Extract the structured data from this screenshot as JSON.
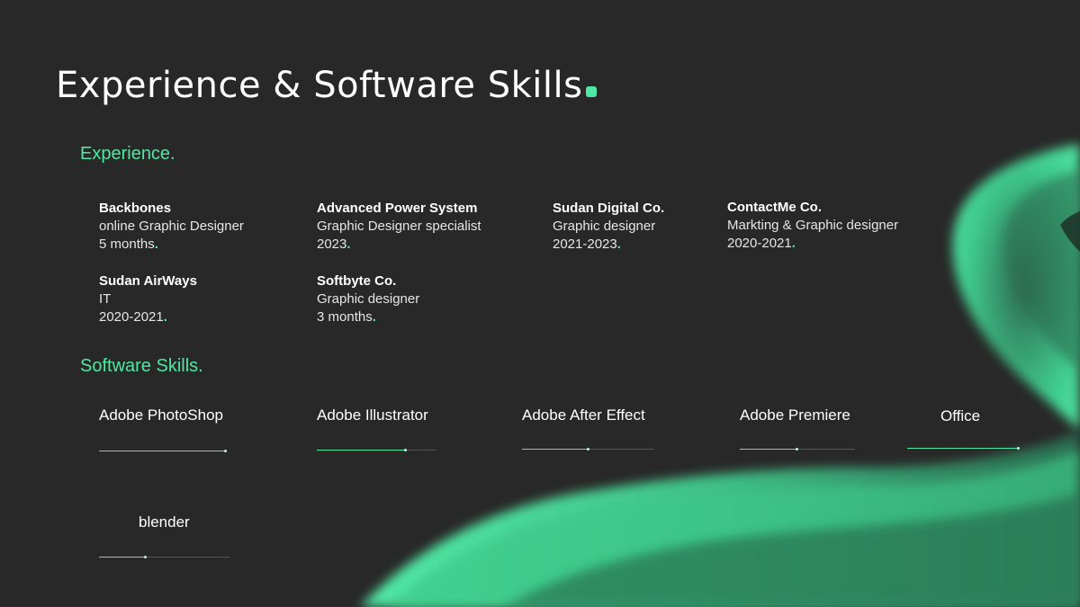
{
  "title": "Experience & Software Skills",
  "colors": {
    "accent": "#4ee8a3",
    "background": "#282828",
    "text": "#ffffff"
  },
  "experience_heading": "Experience.",
  "experience": [
    {
      "company": "Backbones",
      "role": "online Graphic Designer",
      "period": "5 months"
    },
    {
      "company": "Advanced Power System",
      "role": "Graphic Designer specialist",
      "period": "2023"
    },
    {
      "company": "Sudan Digital Co.",
      "role": "Graphic designer",
      "period": "2021-2023"
    },
    {
      "company": "ContactMe Co.",
      "role": "Markting & Graphic designer",
      "period": "2020-2021"
    },
    {
      "company": "Sudan AirWays",
      "role": "IT",
      "period": "2020-2021"
    },
    {
      "company": "Softbyte Co.",
      "role": "Graphic designer",
      "period": "3 months"
    }
  ],
  "skills_heading": "Software Skills.",
  "skills": [
    {
      "name": "Adobe PhotoShop",
      "level": 0.99
    },
    {
      "name": "Adobe Illustrator",
      "level": 0.75
    },
    {
      "name": "Adobe After Effect",
      "level": 0.5
    },
    {
      "name": "Adobe Premiere",
      "level": 0.5
    },
    {
      "name": "Office",
      "level": 0.99
    },
    {
      "name": "blender",
      "level": 0.36
    }
  ]
}
